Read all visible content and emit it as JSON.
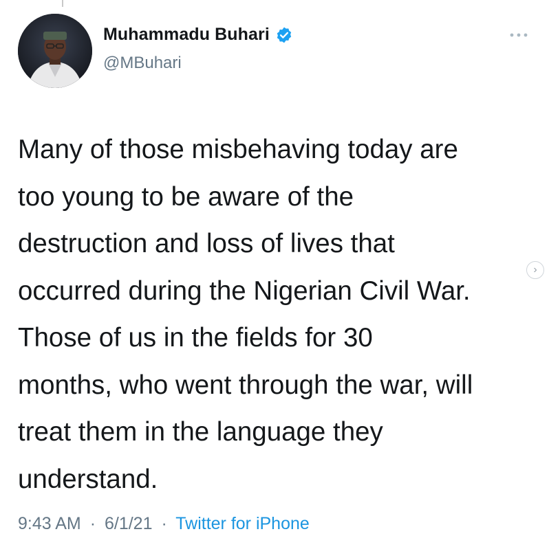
{
  "author": {
    "display_name": "Muhammadu Buhari",
    "handle": "@MBuhari",
    "verified": true,
    "avatar_icon": "profile-photo"
  },
  "tweet": {
    "text": "Many of those misbehaving today are\ntoo young to be aware of the\ndestruction and loss of lives that\noccurred during the Nigerian Civil War.\nThose of us in the fields for 30\nmonths, who went through the war, will\ntreat them in the language they\nunderstand."
  },
  "meta": {
    "time": "9:43 AM",
    "separator": "·",
    "date": "6/1/21",
    "source": "Twitter for iPhone"
  },
  "colors": {
    "text": "#14171a",
    "secondary": "#657786",
    "accent": "#1b95e0",
    "background": "#ffffff"
  },
  "icons": {
    "more": "more-options-icon",
    "verified": "verified-badge-icon",
    "next": "chevron-right-icon"
  }
}
